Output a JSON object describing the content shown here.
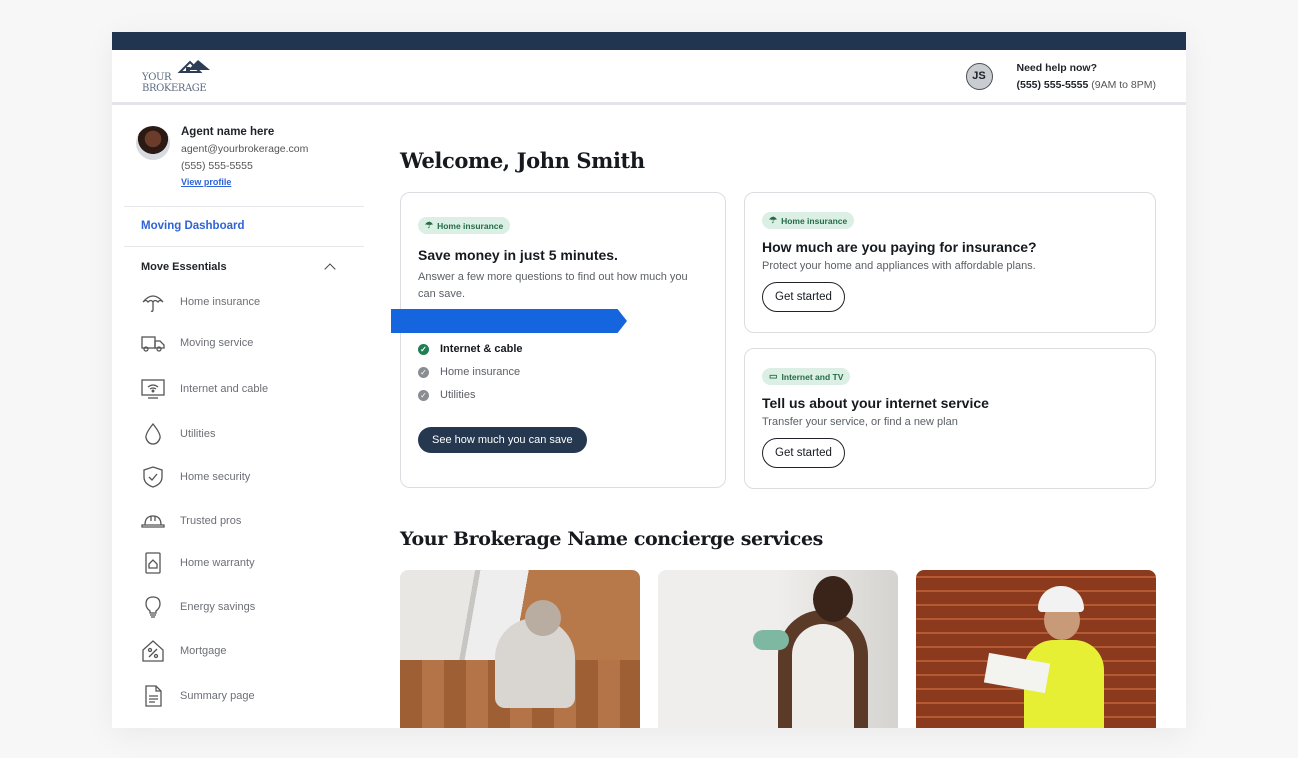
{
  "header": {
    "logo_text": "YOUR BROKERAGE",
    "user_initials": "JS",
    "help_title": "Need help now?",
    "help_phone": "(555) 555-5555",
    "help_hours": "(9AM to 8PM)"
  },
  "agent": {
    "name": "Agent name here",
    "email": "agent@yourbrokerage.com",
    "phone": "(555) 555-5555",
    "profile_link": "View profile"
  },
  "sidebar": {
    "active_item": "Moving Dashboard",
    "section_title": "Move Essentials",
    "items": [
      {
        "label": "Home insurance",
        "icon": "umbrella-icon"
      },
      {
        "label": "Moving service",
        "icon": "truck-icon"
      },
      {
        "label": "Internet and cable",
        "icon": "wifi-monitor-icon"
      },
      {
        "label": "Utilities",
        "icon": "water-drop-icon"
      },
      {
        "label": "Home security",
        "icon": "shield-check-icon"
      },
      {
        "label": "Trusted pros",
        "icon": "hard-hat-icon"
      },
      {
        "label": "Home warranty",
        "icon": "house-doc-icon"
      },
      {
        "label": "Energy savings",
        "icon": "lightbulb-icon"
      },
      {
        "label": "Mortgage",
        "icon": "percent-house-icon"
      },
      {
        "label": "Summary page",
        "icon": "document-icon"
      }
    ]
  },
  "main": {
    "welcome": "Welcome, John Smith",
    "card_savings": {
      "tag": "Home insurance",
      "title": "Save money in just 5 minutes.",
      "subtitle": "Answer a few more questions to find out how much you can save.",
      "checklist": [
        {
          "label": "Internet & cable",
          "done": true
        },
        {
          "label": "Home insurance",
          "done": false
        },
        {
          "label": "Utilities",
          "done": false
        }
      ],
      "button": "See how much you can save"
    },
    "card_insurance": {
      "tag": "Home insurance",
      "title": "How much are you paying for insurance?",
      "subtitle": "Protect your home and appliances with affordable plans.",
      "button": "Get started"
    },
    "card_internet": {
      "tag": "Internet and TV",
      "title": "Tell us about your internet service",
      "subtitle": "Transfer your service, or find a new plan",
      "button": "Get started"
    },
    "concierge_title": "Your Brokerage Name concierge services"
  },
  "colors": {
    "topbar": "#213550",
    "accent_link": "#2f63d6",
    "ribbon": "#1565df",
    "tag_bg": "#dbefe4",
    "check_done": "#1d7f53",
    "dark_button": "#263850"
  }
}
